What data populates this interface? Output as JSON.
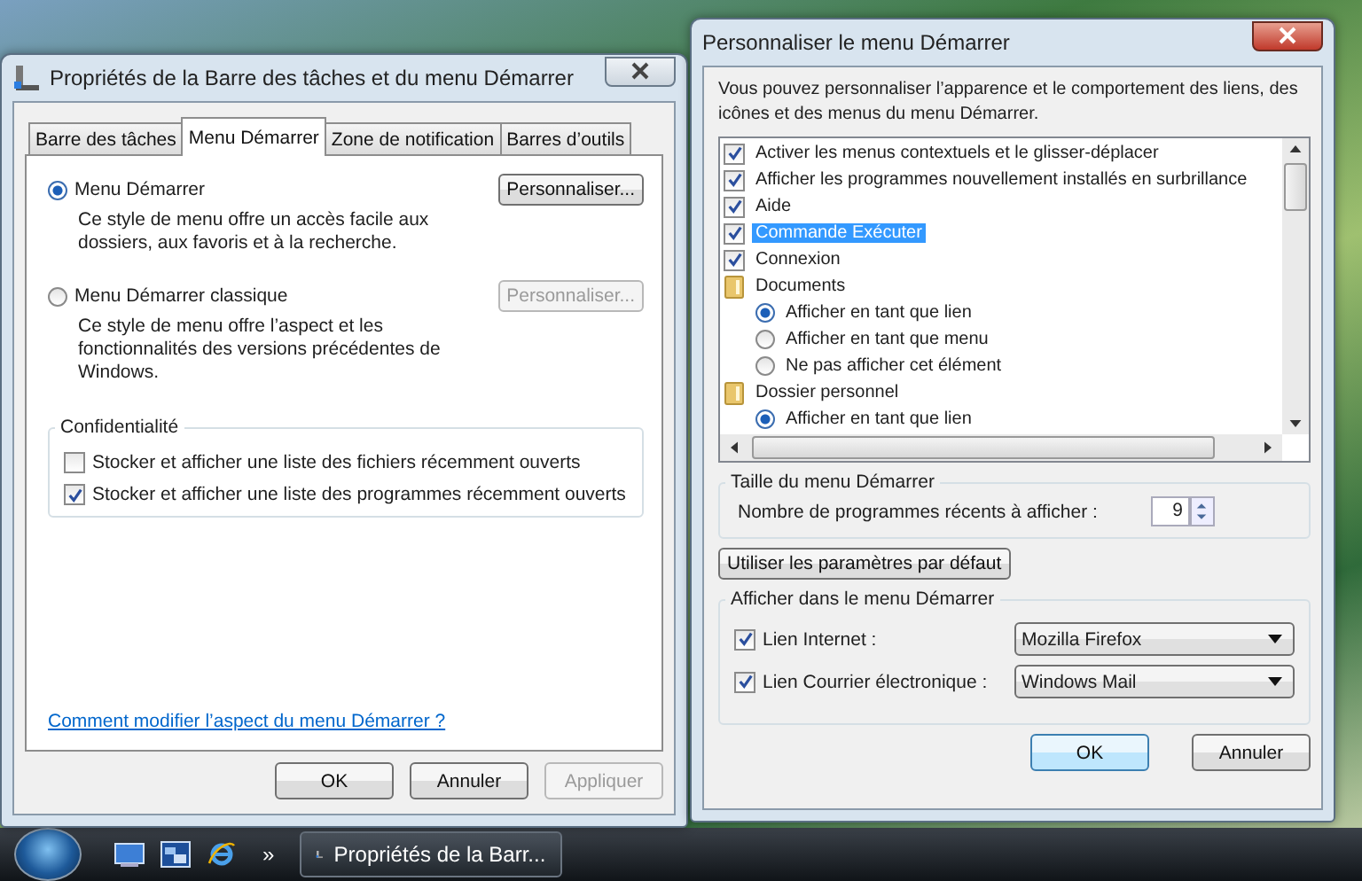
{
  "left_window": {
    "title": "Propriétés de la Barre des tâches et du menu Démarrer",
    "tabs": [
      {
        "label": "Barre des tâches",
        "selected": false
      },
      {
        "label": "Menu Démarrer",
        "selected": true
      },
      {
        "label": "Zone de notification",
        "selected": false
      },
      {
        "label": "Barres d’outils",
        "selected": false
      }
    ],
    "options": [
      {
        "label": "Menu Démarrer",
        "selected": true,
        "description": "Ce style de menu offre un accès facile aux dossiers, aux favoris et à la recherche.",
        "button": {
          "label": "Personnaliser...",
          "disabled": false
        }
      },
      {
        "label": "Menu Démarrer classique",
        "selected": false,
        "description": "Ce style de menu offre l’aspect et les fonctionnalités des versions précédentes de Windows.",
        "button": {
          "label": "Personnaliser...",
          "disabled": true
        }
      }
    ],
    "privacy": {
      "title": "Confidentialité",
      "checkboxes": [
        {
          "label": "Stocker et afficher une liste des fichiers récemment ouverts",
          "checked": false
        },
        {
          "label": "Stocker et afficher une liste des programmes récemment ouverts",
          "checked": true
        }
      ]
    },
    "help_link": "Comment modifier l’aspect du menu Démarrer ?",
    "buttons": [
      {
        "label": "OK",
        "disabled": false
      },
      {
        "label": "Annuler",
        "disabled": false
      },
      {
        "label": "Appliquer",
        "disabled": true
      }
    ]
  },
  "right_window": {
    "title": "Personnaliser le menu Démarrer",
    "intro": "Vous pouvez personnaliser l’apparence et le comportement des liens, des icônes et des menus du menu Démarrer.",
    "tree": [
      {
        "kind": "checkbox",
        "label": "Activer les menus contextuels et le glisser-déplacer",
        "checked": true,
        "highlighted": false
      },
      {
        "kind": "checkbox",
        "label": "Afficher les programmes nouvellement installés en surbrillance",
        "checked": true,
        "highlighted": false
      },
      {
        "kind": "checkbox",
        "label": "Aide",
        "checked": true,
        "highlighted": false
      },
      {
        "kind": "checkbox",
        "label": "Commande Exécuter",
        "checked": true,
        "highlighted": true
      },
      {
        "kind": "checkbox",
        "label": "Connexion",
        "checked": true,
        "highlighted": false
      },
      {
        "kind": "folder",
        "label": "Documents",
        "children": [
          {
            "label": "Afficher en tant que lien",
            "selected": true
          },
          {
            "label": "Afficher en tant que menu",
            "selected": false
          },
          {
            "label": "Ne pas afficher cet élément",
            "selected": false
          }
        ]
      },
      {
        "kind": "folder",
        "label": "Dossier personnel",
        "children": [
          {
            "label": "Afficher en tant que lien",
            "selected": true
          }
        ]
      }
    ],
    "size_group": {
      "title": "Taille du menu Démarrer",
      "label": "Nombre de programmes récents à afficher :",
      "value": "9"
    },
    "default_button": "Utiliser les paramètres par défaut",
    "show_group": {
      "title": "Afficher dans le menu Démarrer",
      "links": [
        {
          "label": "Lien Internet :",
          "checked": true,
          "value": "Mozilla Firefox"
        },
        {
          "label": "Lien Courrier électronique :",
          "checked": true,
          "value": "Windows Mail"
        }
      ]
    },
    "buttons": [
      {
        "label": "OK",
        "default": true
      },
      {
        "label": "Annuler",
        "default": false
      }
    ]
  },
  "taskbar": {
    "overflow": "»",
    "items": [
      {
        "label": "Propriétés de la Barr...",
        "selected": true
      }
    ]
  }
}
